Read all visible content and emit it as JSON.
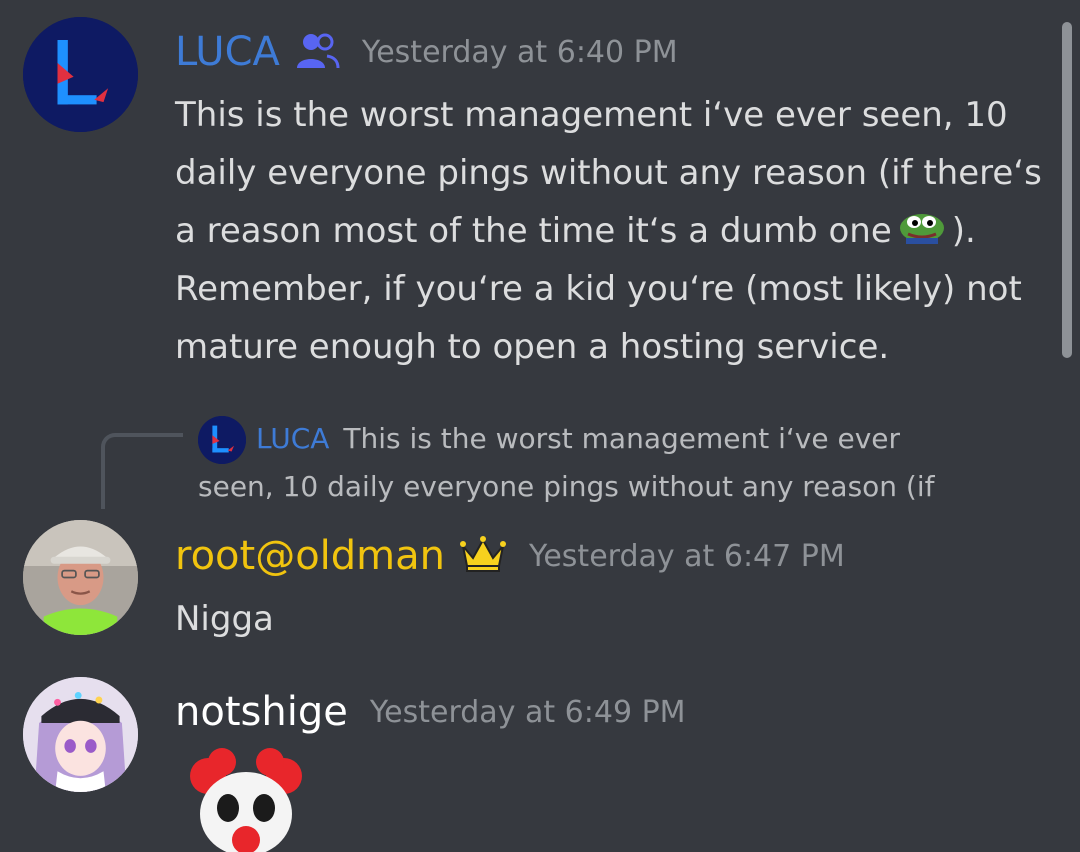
{
  "messages": [
    {
      "author": "LUCA",
      "timestamp": "Yesterday at 6:40 PM",
      "badge_icon": "members-icon",
      "lines": [
        "This is the worst management i‘ve ever seen, 10",
        "daily everyone pings without any reason (if there‘s",
        "a reason most of the time it‘s a dumb one",
        ").",
        "Remember, if you‘re a kid you‘re (most likely) not",
        "mature enough to open a hosting service."
      ],
      "inline_emoji": "pepe-emoji"
    },
    {
      "reply_to": {
        "author": "LUCA",
        "preview_line1": "This is the worst management i‘ve ever",
        "preview_line2": "seen, 10 daily everyone pings without any reason (if"
      },
      "author": "root@oldman",
      "timestamp": "Yesterday at 6:47 PM",
      "badge_icon": "crown-icon",
      "text": "Nigga"
    },
    {
      "author": "notshige",
      "timestamp": "Yesterday at 6:49 PM",
      "emoji": "clown-emoji"
    }
  ],
  "colors": {
    "background": "#36393f",
    "luca_name": "#3e7bd6",
    "root_name": "#f1c40f",
    "timestamp": "#8e9297",
    "text": "#dcddde"
  }
}
